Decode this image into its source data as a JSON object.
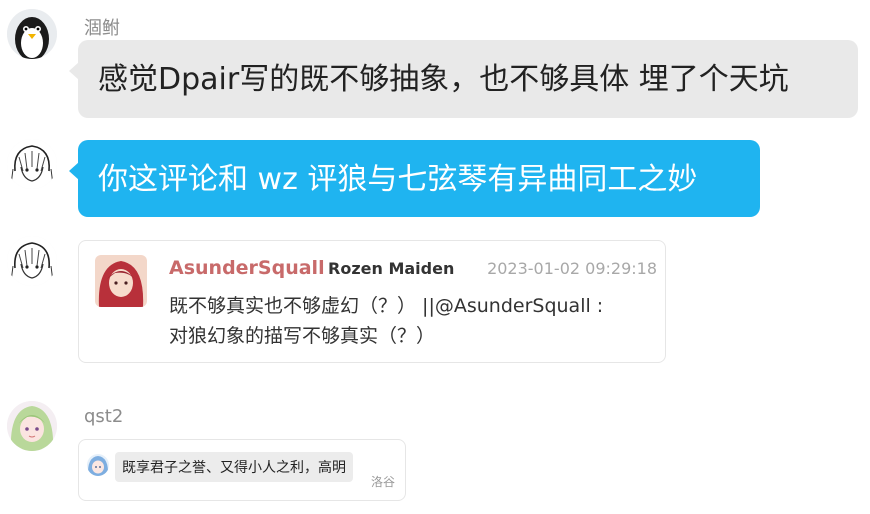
{
  "messages": [
    {
      "username": "涸鲋",
      "avatar_icon": "penguin-icon",
      "text": "感觉Dpair写的既不够抽象，也不够具体 埋了个天坑"
    },
    {
      "avatar_icon": "sketch-anime-girl-icon",
      "text": "你这评论和 wz 评狼与七弦琴有异曲同工之妙"
    },
    {
      "avatar_icon": "sketch-anime-girl-icon",
      "quote_card": {
        "author": "AsunderSquall",
        "tag": "Rozen Maiden",
        "time": "2023-01-02 09:29:18",
        "line1": "既不够真实也不够虚幻（？） ||@AsunderSquall :",
        "line2": "对狼幻象的描写不够真实（？）"
      }
    },
    {
      "username": "qst2",
      "avatar_icon": "anime-girl-green-hair-icon",
      "forward_card": {
        "inner_avatar_icon": "anime-girl-blue-hair-icon",
        "text": "既享君子之誉、又得小人之利，高明",
        "source": "洛谷"
      }
    }
  ],
  "colors": {
    "bubble_gray": "#e9e9e9",
    "bubble_blue": "#1fb4f0",
    "author_color": "#c86a6a"
  }
}
